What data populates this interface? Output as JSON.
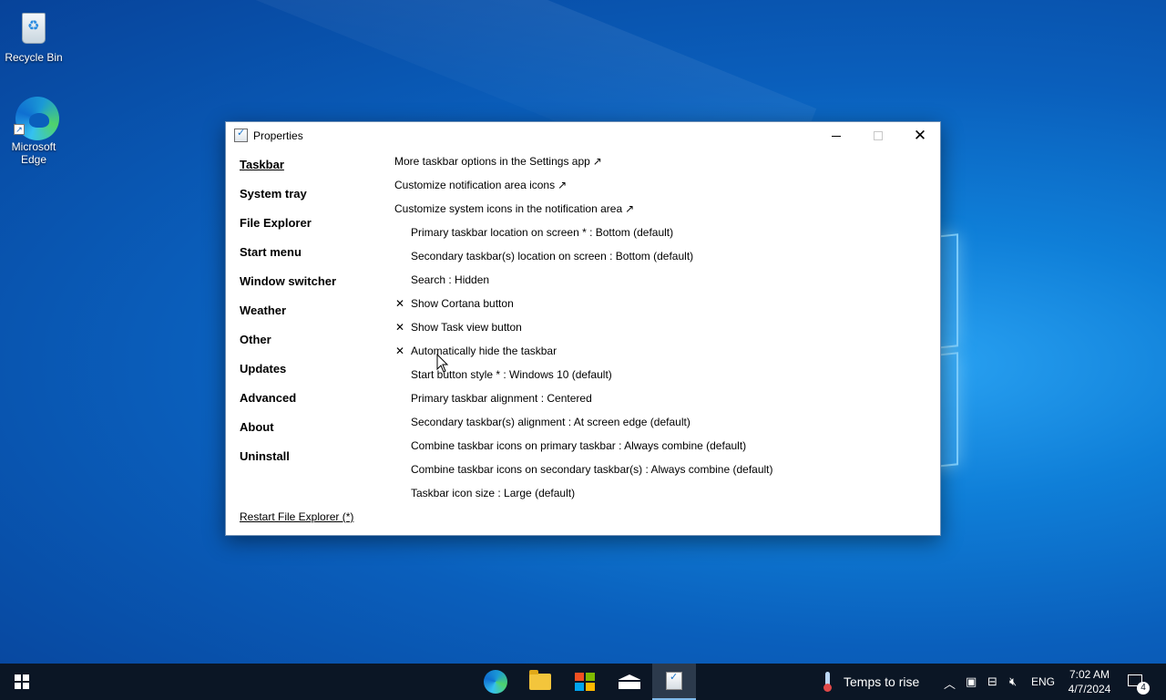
{
  "desktop": {
    "icons": [
      {
        "label": "Recycle Bin",
        "icon": "recycle-bin-icon"
      },
      {
        "label": "Microsoft Edge",
        "icon": "edge-icon"
      }
    ]
  },
  "window": {
    "title": "Properties",
    "controls": {
      "minimize": "minimize-icon",
      "maximize": "maximize-icon",
      "close": "✕"
    },
    "nav": {
      "items": [
        "Taskbar",
        "System tray",
        "File Explorer",
        "Start menu",
        "Window switcher",
        "Weather",
        "Other",
        "Updates",
        "Advanced",
        "About",
        "Uninstall"
      ],
      "active": "Taskbar",
      "restart_label": "Restart File Explorer (*)"
    },
    "links": [
      {
        "label": "More taskbar options in the Settings app",
        "arrow": "↗"
      },
      {
        "label": "Customize notification area icons",
        "arrow": "↗"
      },
      {
        "label": "Customize system icons in the notification area",
        "arrow": "↗"
      }
    ],
    "settings": [
      {
        "label": "Primary taskbar location on screen * : Bottom (default)",
        "check": ""
      },
      {
        "label": "Secondary taskbar(s) location on screen : Bottom (default)",
        "check": ""
      },
      {
        "label": "Search : Hidden",
        "check": ""
      },
      {
        "label": "Show Cortana button",
        "check": "✕"
      },
      {
        "label": "Show Task view button",
        "check": "✕"
      },
      {
        "label": "Automatically hide the taskbar",
        "check": "✕"
      },
      {
        "label": "Start button style * : Windows 10 (default)",
        "check": ""
      },
      {
        "label": "Primary taskbar alignment : Centered",
        "check": ""
      },
      {
        "label": "Secondary taskbar(s) alignment : At screen edge (default)",
        "check": ""
      },
      {
        "label": "Combine taskbar icons on primary taskbar : Always combine (default)",
        "check": ""
      },
      {
        "label": "Combine taskbar icons on secondary taskbar(s) : Always combine (default)",
        "check": ""
      },
      {
        "label": "Taskbar icon size : Large (default)",
        "check": ""
      }
    ]
  },
  "taskbar": {
    "apps": [
      "edge-icon",
      "file-explorer-icon",
      "store-icon",
      "mail-icon",
      "properties-icon"
    ],
    "weather_text": "Temps to rise",
    "tray": {
      "chevron": "^",
      "language": "ENG"
    },
    "clock": {
      "time": "7:02 AM",
      "date": "4/7/2024"
    },
    "notification_count": "4"
  }
}
